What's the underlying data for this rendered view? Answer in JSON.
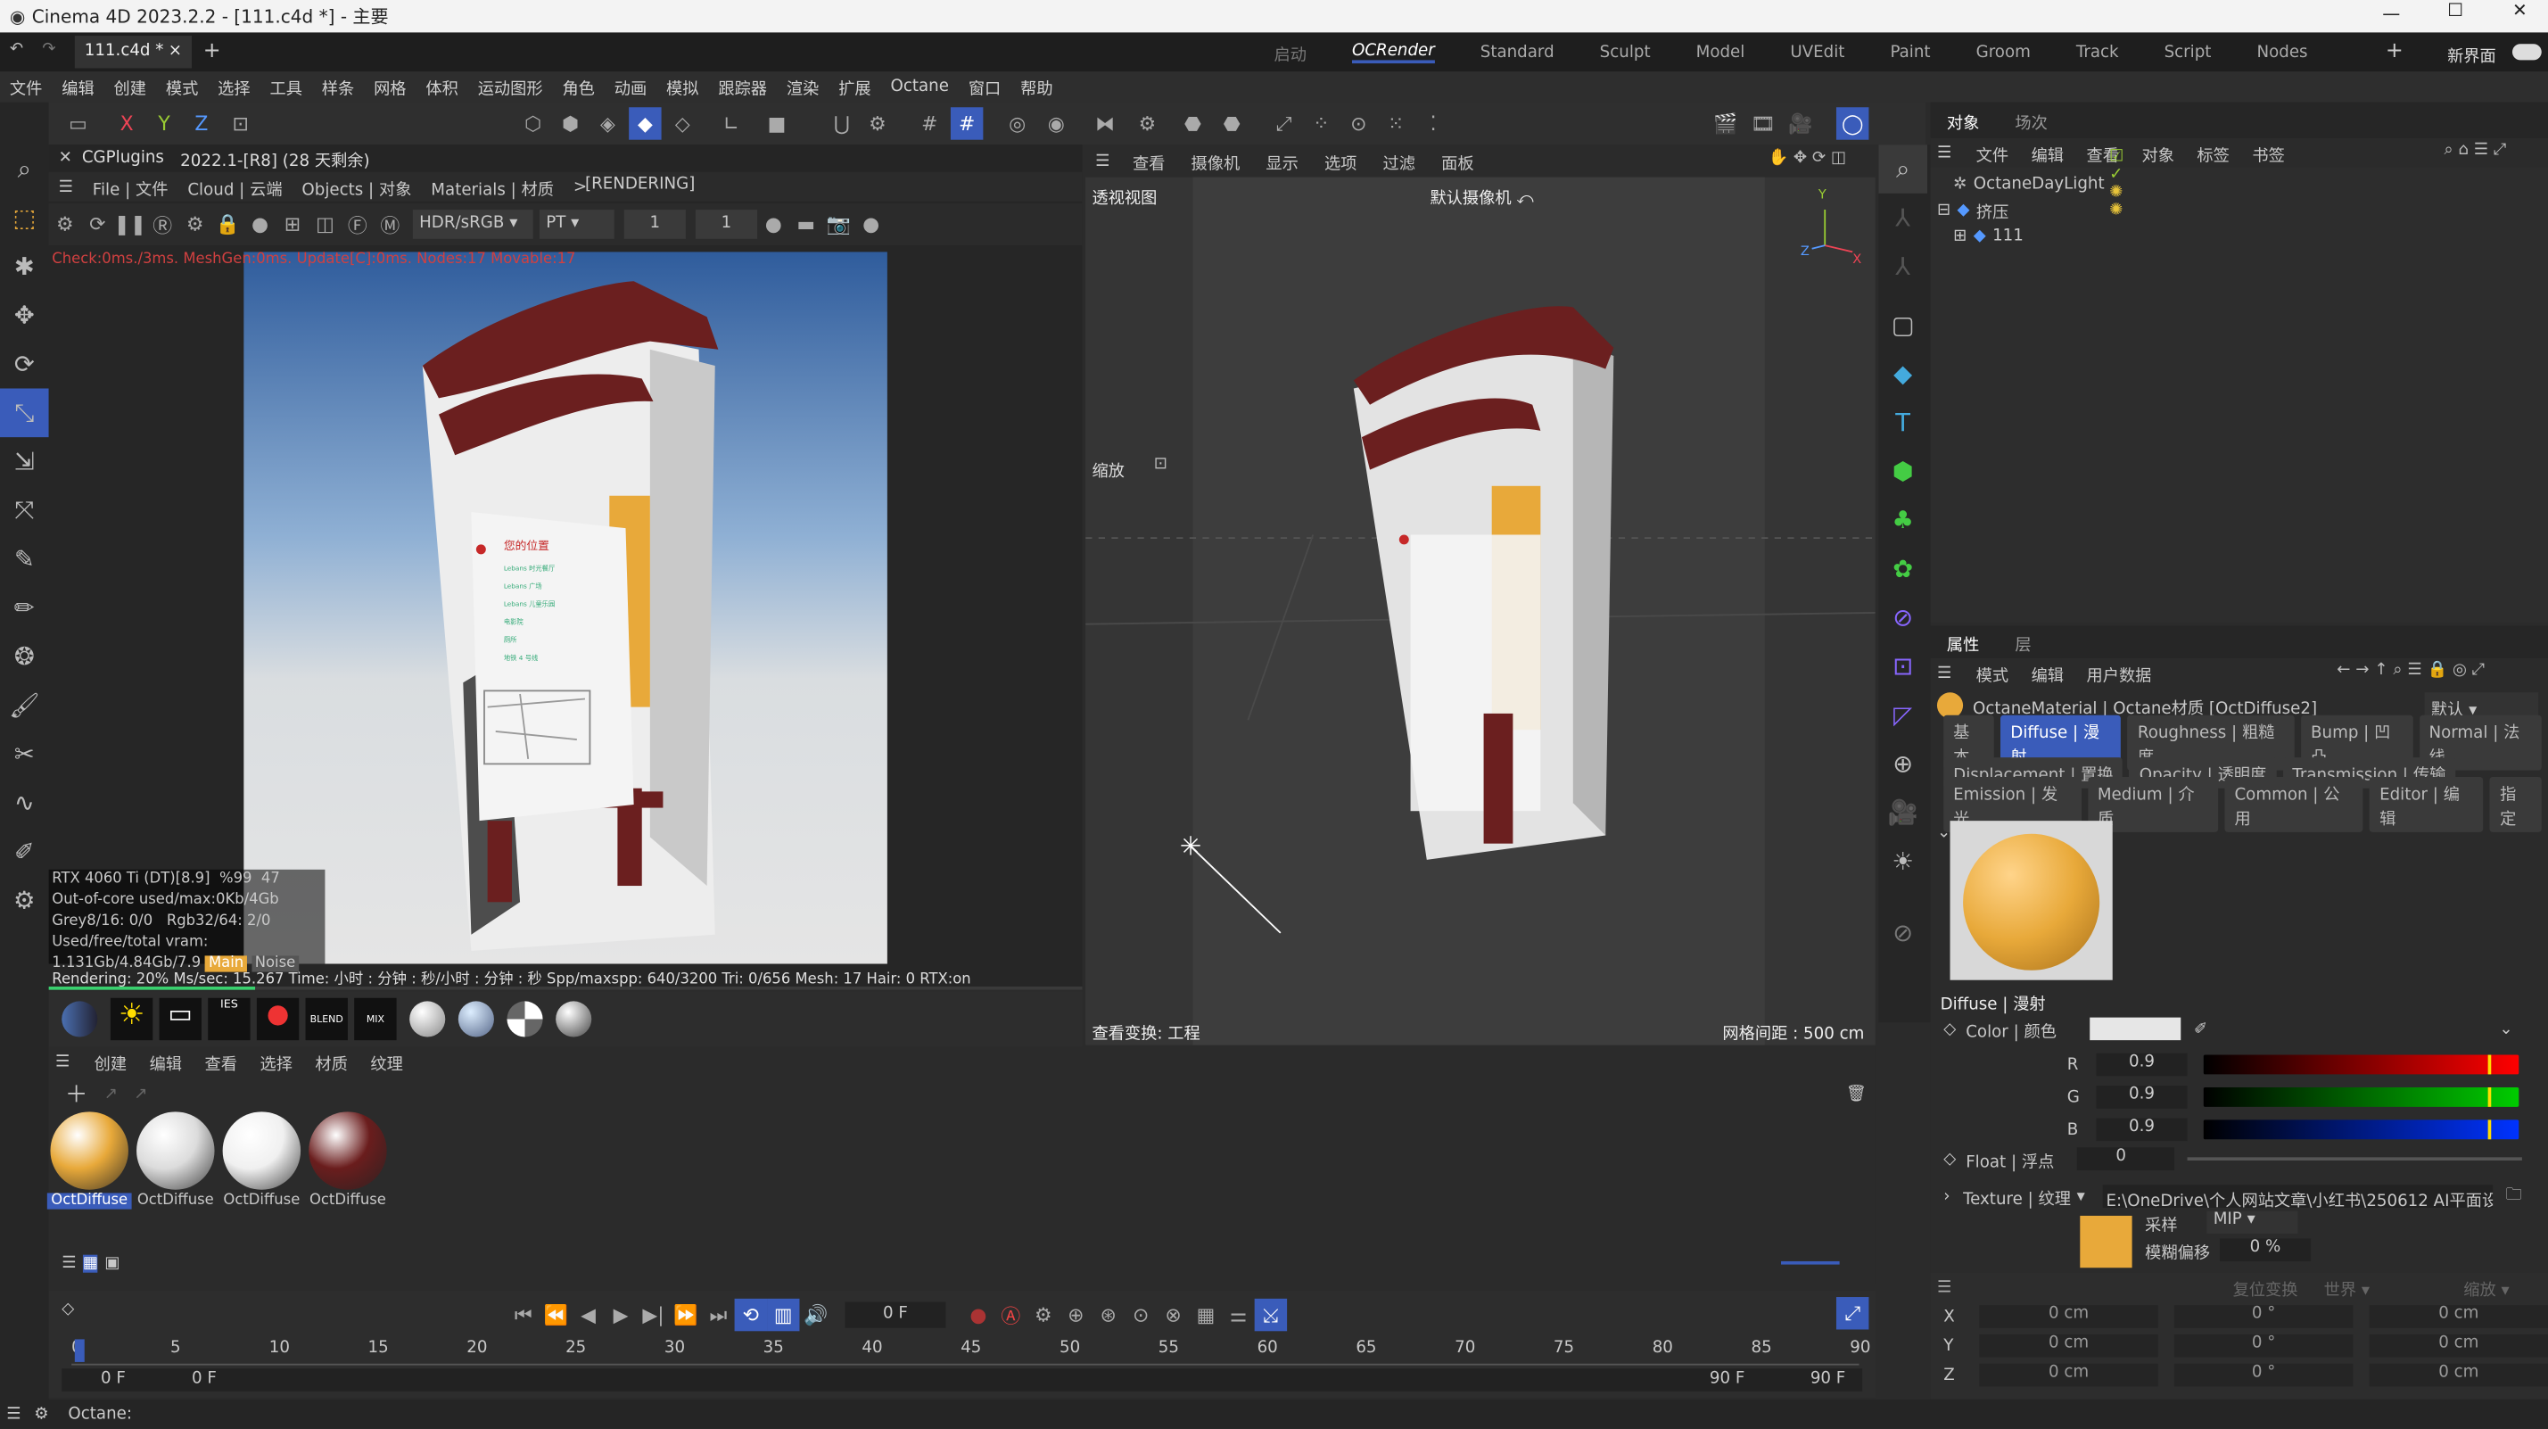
{
  "window": {
    "title": "Cinema 4D 2023.2.2 - [111.c4d *] - 主要",
    "doc_tab": "111.c4d *",
    "close": "×",
    "plus": "+"
  },
  "layouts": [
    "启动",
    "OCRender",
    "Standard",
    "Sculpt",
    "Model",
    "UVEdit",
    "Paint",
    "Groom",
    "Track",
    "Script",
    "Nodes"
  ],
  "layout_active": "OCRender",
  "new_layout": "新界面",
  "menus": [
    "文件",
    "编辑",
    "创建",
    "模式",
    "选择",
    "工具",
    "样条",
    "网格",
    "体积",
    "运动图形",
    "角色",
    "动画",
    "模拟",
    "跟踪器",
    "渲染",
    "扩展",
    "Octane",
    "窗口",
    "帮助"
  ],
  "render_view": {
    "plugin": "CGPlugins",
    "version": "2022.1-[R8] (28 天剩余)",
    "menu": [
      "File | 文件",
      "Cloud | 云端",
      "Objects | 对象",
      "Materials | 材质",
      ">"
    ],
    "status_tag": "[RENDERING]",
    "colorspace": "HDR/sRGB",
    "kernel": "PT",
    "val1": "1",
    "val2": "1",
    "check_line": "Check:0ms./3ms. MeshGen:0ms. Update[C]:0ms. Nodes:17 Movable:17",
    "gpu": "RTX 4060 Ti (DT)[8.9]",
    "gpu_pct": "%99",
    "gpu_temp": "47",
    "ooc": "Out-of-core used/max:0Kb/4Gb",
    "grey_label": "Grey8/16: 0/0",
    "rgb_label": "Rgb32/64: 2/0",
    "vram": "Used/free/total vram: 1.131Gb/4.84Gb/7.9",
    "main_tag": "Main",
    "noise_tag": "Noise",
    "render_line": "Rendering: 20%  Ms/sec: 15.267   Time: 小时 : 分钟 : 秒/小时 : 分钟 : 秒   Spp/maxspp: 640/3200   Tri: 0/656   Mesh: 17   Hair: 0   RTX:on",
    "progress": 0.2
  },
  "viewport": {
    "menu": [
      "查看",
      "摄像机",
      "显示",
      "选项",
      "过滤",
      "面板"
    ],
    "name": "透视视图",
    "camera": "默认摄像机",
    "zoom_label": "缩放",
    "transform": "查看变换: 工程",
    "grid": "网格间距 : 500 cm"
  },
  "sign": {
    "title": "您的位置",
    "items": [
      "Lebans 时光餐厅",
      "Lebans 广场",
      "Lebans 儿童乐园",
      "电影院",
      "厕所",
      "地铁 4 号线"
    ]
  },
  "object_manager": {
    "tabs": [
      "对象",
      "场次"
    ],
    "menu": [
      "文件",
      "编辑",
      "查看",
      "对象",
      "标签",
      "书签"
    ],
    "objects": [
      "OctaneDayLight",
      "挤压",
      "111"
    ]
  },
  "attributes": {
    "tabs": [
      "属性",
      "层"
    ],
    "menu": [
      "模式",
      "编辑",
      "用户数据"
    ],
    "material_title": "OctaneMaterial | Octane材质 [OctDiffuse2]",
    "preset": "默认",
    "tab_rows": [
      [
        "基本",
        "Diffuse | 漫射",
        "Roughness | 粗糙度",
        "Bump | 凹凸",
        "Normal | 法线"
      ],
      [
        "Displacement | 置换",
        "Opacity | 透明度",
        "Transmission | 传输"
      ],
      [
        "Emission | 发光",
        "Medium | 介质",
        "Common | 公用",
        "Editor | 编辑",
        "指定"
      ]
    ],
    "active_tab": "Diffuse | 漫射",
    "section": "Diffuse | 漫射",
    "color_label": "Color | 颜色",
    "r_label": "R",
    "g_label": "G",
    "b_label": "B",
    "r": "0.9",
    "g": "0.9",
    "b": "0.9",
    "rgb_level": 0.9,
    "float_label": "Float | 浮点",
    "float_val": "0",
    "texture_label": "Texture | 纹理",
    "texture_path": "E:\\OneDrive\\个人网站文章\\小红书\\250612 AI平面设计转",
    "sample_label": "采样",
    "sample_val": "MIP",
    "blur_label": "模糊偏移",
    "blur_val": "0 %"
  },
  "coords": {
    "head": [
      "复位变换",
      "世界",
      "缩放"
    ],
    "rows": [
      [
        "X",
        "0 cm",
        "0 °",
        "0 cm"
      ],
      [
        "Y",
        "0 cm",
        "0 °",
        "0 cm"
      ],
      [
        "Z",
        "0 cm",
        "0 °",
        "0 cm"
      ]
    ]
  },
  "material_manager": {
    "menu": [
      "创建",
      "编辑",
      "查看",
      "选择",
      "材质",
      "纹理"
    ],
    "materials": [
      {
        "name": "OctDiffuse",
        "color": "#e8a93a"
      },
      {
        "name": "OctDiffuse",
        "color": "#dcdcdc"
      },
      {
        "name": "OctDiffuse",
        "color": "#f0f0f0"
      },
      {
        "name": "OctDiffuse",
        "color": "#6a1d1d"
      }
    ],
    "blend_label": "BLEND",
    "mix_label": "MIX",
    "ies_label": "IES"
  },
  "timeline": {
    "frame": "0 F",
    "ticks": [
      "0",
      "5",
      "10",
      "15",
      "20",
      "25",
      "30",
      "35",
      "40",
      "45",
      "50",
      "55",
      "60",
      "65",
      "70",
      "75",
      "80",
      "85",
      "90"
    ],
    "start": "0 F",
    "start2": "0 F",
    "end": "90 F",
    "end2": "90 F"
  },
  "statusbar": "Octane:",
  "colors": {
    "accent": "#3a5cba",
    "maroon": "#6b1f1f",
    "orange": "#e8a93a"
  }
}
